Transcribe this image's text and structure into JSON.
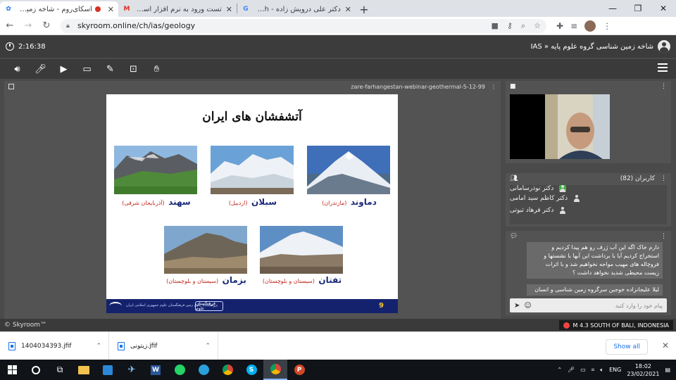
{
  "browser": {
    "tabs": [
      {
        "title": "اسکای‌روم - شاخه زمین شناسی",
        "active": true,
        "recording": true
      },
      {
        "title": "تست ورود به نرم افزار اسکای روم -",
        "active": false
      },
      {
        "title": "دکتر علی درویش زاده - Google Search",
        "active": false
      }
    ],
    "url": "skyroom.online/ch/ias/geology"
  },
  "skyroom": {
    "timer": "2:16:38",
    "room_title": "IAS » شاخه زمین شناسی گروه علوم پایه"
  },
  "presentation": {
    "file_name": "zare-farhangestan-webinar-geothermal-5-12-99",
    "slide": {
      "title": "آتشفشان های ایران",
      "volcanoes": [
        {
          "name": "دماوند",
          "province": "(مازندران)"
        },
        {
          "name": "سبلان",
          "province": "(اردبیل)"
        },
        {
          "name": "سهند",
          "province": "(آذربایجان شرقی)"
        },
        {
          "name": "تفتان",
          "province": "(سیستان و بلوچستان)"
        },
        {
          "name": "بزمان",
          "province": "(سیستان و بلوچستان)"
        }
      ],
      "footer_text": "پژوهشکده علوم زمین فرهنگستان علوم جمهوری اسلامی ایران",
      "footer_logo": "فرهنگستان علوم",
      "page_number": "9"
    }
  },
  "users_panel": {
    "title": "کاربران (82)",
    "users": [
      "دکتر نوذرسامانی",
      "دکتر کاظم سید امامی",
      "دکتر فرهاد ثبوتی"
    ]
  },
  "chat": {
    "messages": [
      "دارم خاک اگه این آب ژرف رو هم پیدا کردیم و استخراج کردیم آیا با برداشت این آبها با نشستها و فروچاله های مهیب مواجه نخواهیم شد و با اثرات زیست محیطی شدید نخواهد داشت ؟",
      "لیلا علیجانزاده خوجین سرگروه زمین شناسی و انسان و"
    ],
    "input_placeholder": "پیام خود را وارد کنید"
  },
  "footer": {
    "brand": "© Skyroom™",
    "news": "M 4.3 SOUTH OF BALI, INDONESIA"
  },
  "downloads": {
    "items": [
      "1404034393.jfif",
      "زیتونی.jfif"
    ],
    "show_all": "Show all"
  },
  "taskbar": {
    "time": "18:02",
    "date": "23/02/2021",
    "lang": "ENG"
  },
  "colors": {
    "accent": "#1a73e8",
    "slide_title_blue": "#1b2a7a",
    "slide_province_red": "#c0261d",
    "slide_footer": "#14226e"
  }
}
